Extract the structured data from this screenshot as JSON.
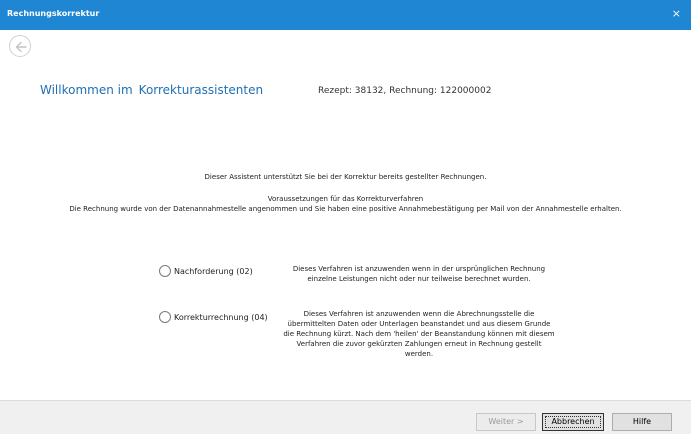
{
  "window": {
    "title": "Rechnungskorrektur",
    "close_glyph": "×"
  },
  "nav": {
    "back_icon": "back-arrow-circle-icon"
  },
  "header": {
    "welcome_part1": "Willkommen im",
    "welcome_part2": "Korrekturassistenten",
    "rezept_info": "Rezept: 38132, Rechnung: 122000002"
  },
  "intro": {
    "line1": "Dieser Assistent unterstützt Sie bei der Korrektur bereits gestellter Rechnungen.",
    "line2": "Voraussetzungen für das Korrekturverfahren",
    "line3": "Die Rechnung wurde von der Datenannahmestelle angenommen und Sie haben eine positive Annahmebestätigung per Mail von der Annahmestelle erhalten."
  },
  "options": [
    {
      "label": "Nachforderung (02)",
      "selected": false,
      "description": "Dieses Verfahren ist anzuwenden wenn in der ursprünglichen Rechnung einzelne Leistungen nicht oder nur teilweise berechnet wurden."
    },
    {
      "label": "Korrekturrechnung (04)",
      "selected": false,
      "description": "Dieses Verfahren ist anzuwenden wenn die Abrechnungsstelle die übermittelten Daten oder Unterlagen beanstandet und aus diesem Grunde die Rechnung kürzt. Nach dem 'heilen' der Beanstandung können mit diesem Verfahren die zuvor gekürzten Zahlungen erneut in Rechnung gestellt werden."
    }
  ],
  "buttons": {
    "next": "Weiter >",
    "cancel": "Abbrechen",
    "help": "Hilfe"
  },
  "colors": {
    "titlebar": "#1f86d4",
    "accent_text": "#1f6fb5"
  }
}
